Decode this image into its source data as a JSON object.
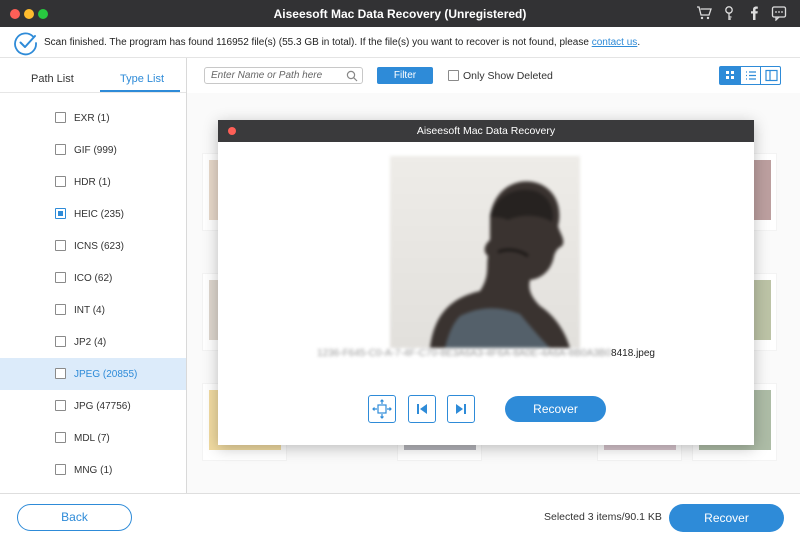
{
  "window": {
    "title": "Aiseesoft Mac Data Recovery (Unregistered)"
  },
  "titlebar_icons": [
    "cart-icon",
    "key-icon",
    "facebook-icon",
    "feedback-icon"
  ],
  "status": {
    "message": "Scan finished. The program has found 116952 file(s) (55.3 GB in total). If the file(s) you want to recover is not found, please ",
    "link": "contact us",
    "suffix": "."
  },
  "tabs": {
    "path_list": "Path List",
    "type_list": "Type List",
    "active": "Type List"
  },
  "types": [
    {
      "label": "EXR (1)",
      "checked": false,
      "selected": false
    },
    {
      "label": "GIF (999)",
      "checked": false,
      "selected": false
    },
    {
      "label": "HDR (1)",
      "checked": false,
      "selected": false
    },
    {
      "label": "HEIC (235)",
      "checked": true,
      "selected": false
    },
    {
      "label": "ICNS (623)",
      "checked": false,
      "selected": false
    },
    {
      "label": "ICO (62)",
      "checked": false,
      "selected": false
    },
    {
      "label": "INT (4)",
      "checked": false,
      "selected": false
    },
    {
      "label": "JP2 (4)",
      "checked": false,
      "selected": false
    },
    {
      "label": "JPEG (20855)",
      "checked": false,
      "selected": true
    },
    {
      "label": "JPG (47756)",
      "checked": false,
      "selected": false
    },
    {
      "label": "MDL (7)",
      "checked": false,
      "selected": false
    },
    {
      "label": "MNG (1)",
      "checked": false,
      "selected": false
    }
  ],
  "toolbar": {
    "search_placeholder": "Enter Name or Path here",
    "filter_label": "Filter",
    "only_deleted_label": "Only Show Deleted"
  },
  "dialog": {
    "title": "Aiseesoft Mac Data Recovery",
    "filename_blurred": "1236-F645-C0-A-7-4F-C70-8E3A6A3-4F6A-8A0E-4A6A-8B0A3B0",
    "filename_visible": "8418.jpeg",
    "recover_label": "Recover"
  },
  "bottom": {
    "back_label": "Back",
    "selected_info": "Selected 3 items/90.1 KB",
    "recover_label": "Recover"
  },
  "colors": {
    "accent": "#2e8bd8",
    "titlebar": "#323234"
  }
}
